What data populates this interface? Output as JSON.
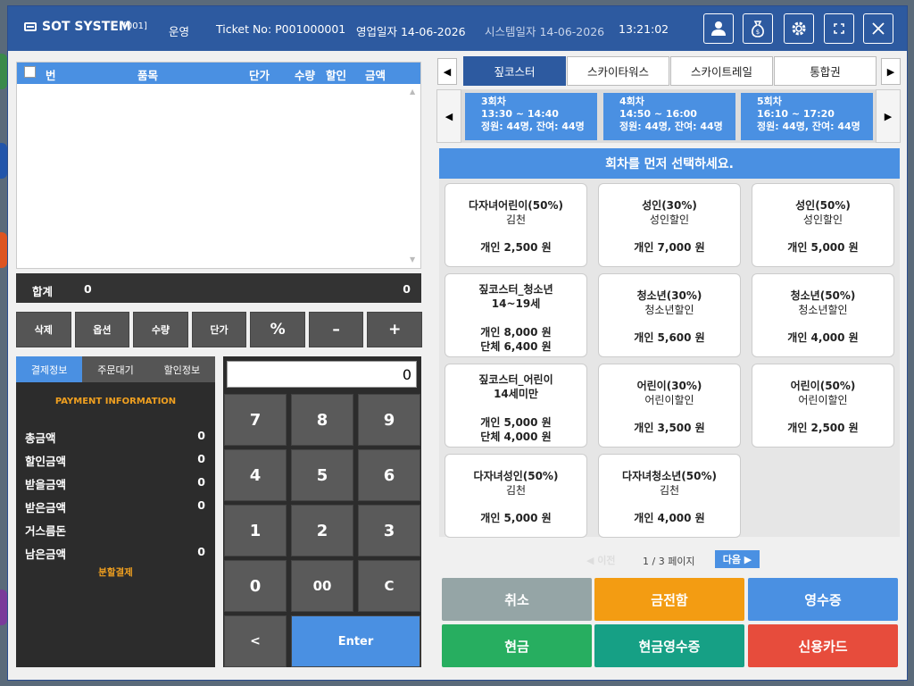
{
  "titlebar": {
    "app_name": "SOT SYSTEM",
    "code": "[001]",
    "mode": "운영",
    "ticket": "Ticket No: P001000001",
    "business_date": "영업일자 14-06-2026",
    "system_date": "시스템일자 14-06-2026",
    "time": "13:21:02",
    "buttons": [
      "user-icon",
      "money-bag-icon",
      "gear-icon",
      "fullscreen-icon",
      "close-icon"
    ]
  },
  "cart": {
    "columns": [
      "번",
      "품목",
      "단가",
      "수량",
      "할인",
      "금액"
    ],
    "total_label": "합계",
    "total_qty": "0",
    "total_amount": "0"
  },
  "function_buttons": [
    "삭제",
    "옵션",
    "수량",
    "단가",
    "%",
    "–",
    "+"
  ],
  "payment": {
    "tabs": [
      "결제정보",
      "주문대기",
      "할인정보"
    ],
    "header": "PAYMENT INFORMATION",
    "rows": [
      {
        "label": "총금액",
        "value": "0"
      },
      {
        "label": "할인금액",
        "value": "0"
      },
      {
        "label": "받을금액",
        "value": "0"
      },
      {
        "label": "받은금액",
        "value": "0"
      },
      {
        "label": "거스름돈",
        "value": ""
      },
      {
        "label": "남은금액",
        "value": "0"
      }
    ],
    "split_label": "분할결제"
  },
  "keypad": {
    "display": "0",
    "keys": [
      "7",
      "8",
      "9",
      "4",
      "5",
      "6",
      "1",
      "2",
      "3",
      "0",
      "00",
      "C",
      "<",
      "Enter"
    ]
  },
  "product_tabs": {
    "items": [
      "짚코스터",
      "스카이타워스",
      "스카이트레일",
      "통합권"
    ],
    "active": "짚코스터"
  },
  "sessions": [
    {
      "round": "3회차",
      "time": "13:30 ~ 14:40",
      "capacity": "정원: 44명, 잔여: 44명"
    },
    {
      "round": "4회차",
      "time": "14:50 ~ 16:00",
      "capacity": "정원: 44명, 잔여: 44명"
    },
    {
      "round": "5회차",
      "time": "16:10 ~ 17:20",
      "capacity": "정원: 44명, 잔여: 44명"
    }
  ],
  "products_message": "회차를 먼저 선택하세요.",
  "products": [
    {
      "name": "다자녀어린이(50%)",
      "sub": "김천",
      "price1": "개인 2,500 원",
      "price2": ""
    },
    {
      "name": "성인(30%)",
      "sub": "성인할인",
      "price1": "개인 7,000 원",
      "price2": ""
    },
    {
      "name": "성인(50%)",
      "sub": "성인할인",
      "price1": "개인 5,000 원",
      "price2": ""
    },
    {
      "name": "짚코스터_청소년",
      "sub": "14~19세",
      "price1": "개인 8,000 원",
      "price2": "단체 6,400 원"
    },
    {
      "name": "청소년(30%)",
      "sub": "청소년할인",
      "price1": "개인 5,600 원",
      "price2": ""
    },
    {
      "name": "청소년(50%)",
      "sub": "청소년할인",
      "price1": "개인 4,000 원",
      "price2": ""
    },
    {
      "name": "짚코스터_어린이",
      "sub": "14세미만",
      "price1": "개인 5,000 원",
      "price2": "단체 4,000 원"
    },
    {
      "name": "어린이(30%)",
      "sub": "어린이할인",
      "price1": "개인 3,500 원",
      "price2": ""
    },
    {
      "name": "어린이(50%)",
      "sub": "어린이할인",
      "price1": "개인 2,500 원",
      "price2": ""
    },
    {
      "name": "다자녀성인(50%)",
      "sub": "김천",
      "price1": "개인 5,000 원",
      "price2": ""
    },
    {
      "name": "다자녀청소년(50%)",
      "sub": "김천",
      "price1": "개인 4,000 원",
      "price2": ""
    }
  ],
  "pager": {
    "prev": "◀ 이전",
    "info": "1 / 3 페이지",
    "next": "다음 ▶"
  },
  "actions": [
    {
      "label": "취소",
      "color": "#95a5a6"
    },
    {
      "label": "금전함",
      "color": "#f39c12"
    },
    {
      "label": "영수증",
      "color": "#4a90e2"
    },
    {
      "label": "현금",
      "color": "#27ae60"
    },
    {
      "label": "현금영수증",
      "color": "#16a085"
    },
    {
      "label": "신용카드",
      "color": "#e74c3c"
    }
  ]
}
